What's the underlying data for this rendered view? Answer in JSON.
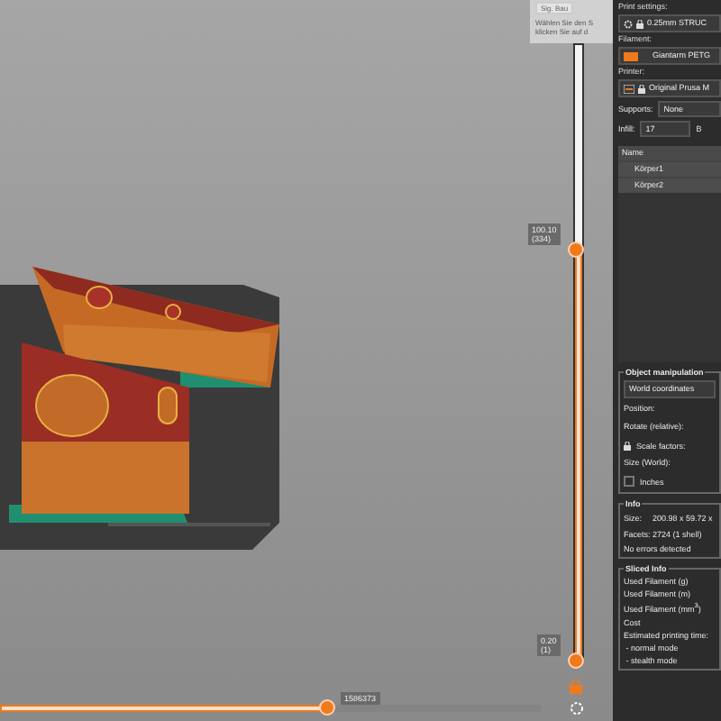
{
  "tooltip": {
    "button": "Sig. Bau",
    "lines": [
      "Wählen Sie den S",
      "klicken Sie auf d"
    ]
  },
  "vertical_slider": {
    "level": 0.67,
    "upper_value": "100.10",
    "upper_layer": "(334)",
    "lower_value": "0.20",
    "lower_layer": "(1)"
  },
  "horizontal_slider": {
    "level": 0.6,
    "value": "1586373"
  },
  "sidebar": {
    "print_settings": {
      "label": "Print settings:",
      "value": "0.25mm STRUC"
    },
    "filament": {
      "label": "Filament:",
      "value": "Giantarm PETG",
      "color": "#f07a1a"
    },
    "printer": {
      "label": "Printer:",
      "value": "Original Prusa M"
    },
    "supports": {
      "label": "Supports:",
      "value": "None"
    },
    "infill": {
      "label": "Infill:",
      "value": "17",
      "next_label": "B"
    },
    "objects": {
      "header": "Name",
      "items": [
        {
          "name": "Körper1"
        },
        {
          "name": "Körper2"
        }
      ]
    },
    "object_manipulation": {
      "title": "Object manipulation",
      "coordinates": "World coordinates",
      "rows": [
        {
          "kind": "text",
          "label": "Position:"
        },
        {
          "kind": "text",
          "label": "Rotate (relative):"
        },
        {
          "kind": "lock",
          "label": "Scale factors:"
        },
        {
          "kind": "text",
          "label": "Size (World):"
        },
        {
          "kind": "checkbox",
          "label": "Inches",
          "checked": false
        }
      ]
    },
    "info": {
      "title": "Info",
      "rows": [
        {
          "label": "Size:",
          "value": "200.98 x 59.72 x"
        },
        {
          "label": "Facets:",
          "value": "2724 (1 shell)"
        }
      ],
      "status": "No errors detected"
    },
    "sliced_info": {
      "title": "Sliced Info",
      "lines": [
        "Used Filament (g)",
        "Used Filament (m)",
        "Used Filament (mm$^{3}$)",
        "Cost",
        "Estimated printing time:",
        " - normal mode",
        " - stealth mode"
      ]
    }
  }
}
